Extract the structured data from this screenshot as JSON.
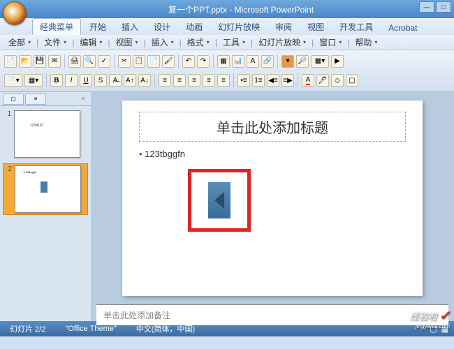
{
  "titlebar": {
    "filename": "复一个PPT.pptx - Microsoft PowerPoint"
  },
  "ribbon": {
    "tabs": [
      "经典菜单",
      "开始",
      "插入",
      "设计",
      "动画",
      "幻灯片放映",
      "审阅",
      "视图",
      "开发工具",
      "Acrobat"
    ],
    "active": 0
  },
  "submenu": {
    "items": [
      "全部",
      "文件",
      "编辑",
      "视图",
      "插入",
      "格式",
      "工具",
      "幻灯片放映",
      "窗口",
      "帮助"
    ]
  },
  "panel": {
    "thumbs": [
      {
        "num": "1",
        "text": "1234107"
      },
      {
        "num": "2",
        "text": "123tbggfn"
      }
    ],
    "selected": 1
  },
  "slide": {
    "title_placeholder": "单击此处添加标题",
    "bullet_text": "123tbggfn"
  },
  "notes": {
    "placeholder": "单击此处添加备注"
  },
  "statusbar": {
    "slide_info": "幻灯片 2/2",
    "theme": "\"Office Theme\"",
    "lang": "中文(简体，中国)"
  },
  "watermark": {
    "main": "经验啦",
    "sub": "jingyanla.com"
  }
}
